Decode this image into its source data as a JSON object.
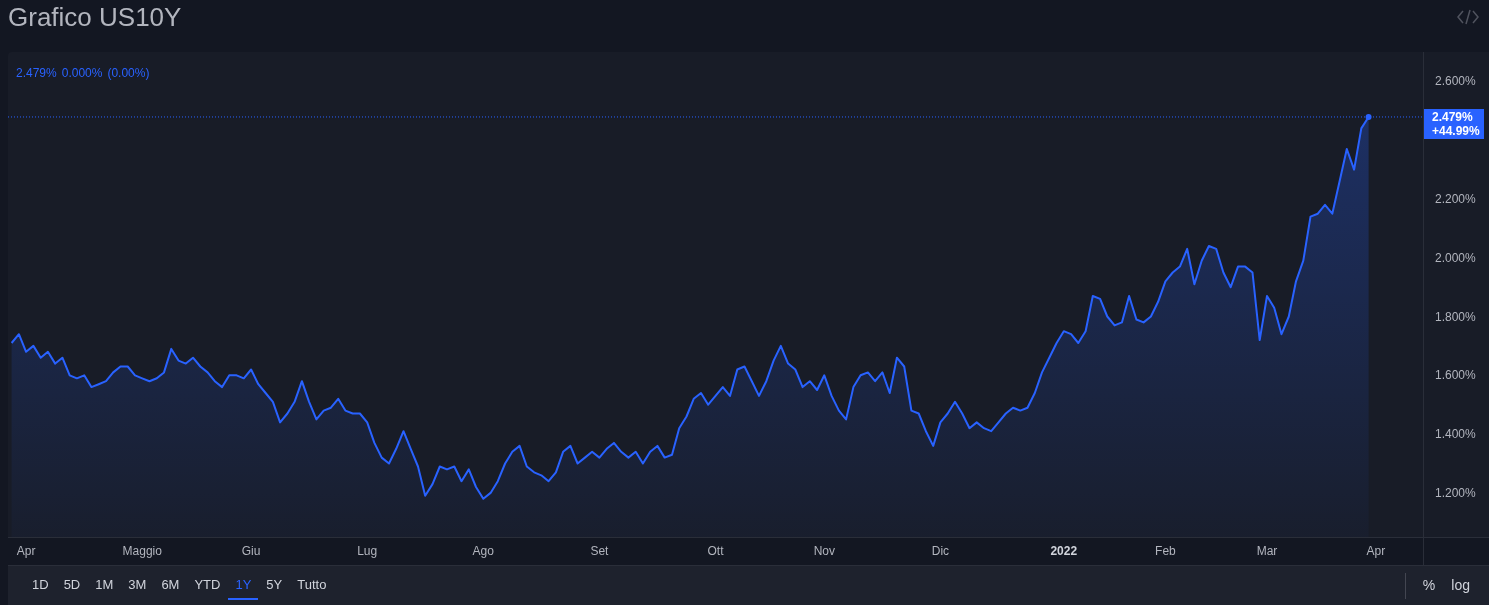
{
  "header": {
    "title": "Grafico US10Y"
  },
  "legend": {
    "price": "2.479%",
    "change": "0.000%",
    "change_pct": "(0.00%)"
  },
  "price_badge": {
    "price": "2.479%",
    "change": "+44.99%"
  },
  "chart_data": {
    "type": "area",
    "ylim": [
      1.05,
      2.7
    ],
    "ref_lines": [
      {
        "axis": "y",
        "value": 2.479
      }
    ],
    "categories": [
      null,
      null,
      "Apr",
      null,
      null,
      null,
      null,
      null,
      null,
      null,
      null,
      null,
      null,
      null,
      null,
      null,
      null,
      null,
      "Maggio",
      null,
      null,
      null,
      null,
      null,
      null,
      null,
      null,
      null,
      null,
      null,
      null,
      null,
      null,
      "Giu",
      null,
      null,
      null,
      null,
      null,
      null,
      null,
      null,
      null,
      null,
      null,
      null,
      null,
      null,
      null,
      "Lug",
      null,
      null,
      null,
      null,
      null,
      null,
      null,
      null,
      null,
      null,
      null,
      null,
      null,
      null,
      null,
      "Ago",
      null,
      null,
      null,
      null,
      null,
      null,
      null,
      null,
      null,
      null,
      null,
      null,
      null,
      null,
      null,
      "Set",
      null,
      null,
      null,
      null,
      null,
      null,
      null,
      null,
      null,
      null,
      null,
      null,
      null,
      null,
      null,
      "Ott",
      null,
      null,
      null,
      null,
      null,
      null,
      null,
      null,
      null,
      null,
      null,
      null,
      null,
      null,
      "Nov",
      null,
      null,
      null,
      null,
      null,
      null,
      null,
      null,
      null,
      null,
      null,
      null,
      null,
      null,
      null,
      "Dic",
      null,
      null,
      null,
      null,
      null,
      null,
      null,
      null,
      null,
      null,
      null,
      null,
      null,
      null,
      null,
      null,
      "2022",
      null,
      null,
      null,
      null,
      null,
      null,
      null,
      null,
      null,
      null,
      null,
      null,
      null,
      "Feb",
      null,
      null,
      null,
      null,
      null,
      null,
      null,
      null,
      null,
      null,
      null,
      null,
      null,
      "Mar",
      null,
      null,
      null,
      null,
      null,
      null,
      null,
      null,
      null,
      null,
      null,
      null,
      null,
      null,
      "Apr",
      null,
      null,
      null,
      null,
      null,
      null
    ],
    "yticks": [
      {
        "value": 1.2,
        "label": "1.200%"
      },
      {
        "value": 1.4,
        "label": "1.400%"
      },
      {
        "value": 1.6,
        "label": "1.600%"
      },
      {
        "value": 1.8,
        "label": "1.800%"
      },
      {
        "value": 2.0,
        "label": "2.000%"
      },
      {
        "value": 2.2,
        "label": "2.200%"
      },
      {
        "value": 2.6,
        "label": "2.600%"
      }
    ],
    "series": [
      {
        "color": "#2962ff",
        "values": [
          1.71,
          1.74,
          1.68,
          1.7,
          1.66,
          1.68,
          1.64,
          1.66,
          1.6,
          1.59,
          1.6,
          1.56,
          1.57,
          1.58,
          1.61,
          1.63,
          1.63,
          1.6,
          1.59,
          1.58,
          1.59,
          1.61,
          1.69,
          1.65,
          1.64,
          1.66,
          1.63,
          1.61,
          1.58,
          1.56,
          1.6,
          1.6,
          1.59,
          1.62,
          1.57,
          1.54,
          1.51,
          1.44,
          1.47,
          1.51,
          1.58,
          1.51,
          1.45,
          1.48,
          1.49,
          1.52,
          1.48,
          1.47,
          1.47,
          1.44,
          1.37,
          1.32,
          1.3,
          1.35,
          1.41,
          1.35,
          1.29,
          1.19,
          1.23,
          1.29,
          1.28,
          1.29,
          1.24,
          1.28,
          1.22,
          1.18,
          1.2,
          1.24,
          1.3,
          1.34,
          1.36,
          1.29,
          1.27,
          1.26,
          1.24,
          1.27,
          1.34,
          1.36,
          1.3,
          1.32,
          1.34,
          1.32,
          1.35,
          1.37,
          1.34,
          1.32,
          1.34,
          1.3,
          1.34,
          1.36,
          1.32,
          1.33,
          1.42,
          1.46,
          1.52,
          1.54,
          1.5,
          1.53,
          1.56,
          1.53,
          1.62,
          1.63,
          1.58,
          1.53,
          1.58,
          1.65,
          1.7,
          1.64,
          1.62,
          1.56,
          1.58,
          1.55,
          1.6,
          1.53,
          1.48,
          1.45,
          1.56,
          1.6,
          1.61,
          1.58,
          1.61,
          1.54,
          1.66,
          1.63,
          1.48,
          1.47,
          1.41,
          1.36,
          1.44,
          1.47,
          1.51,
          1.47,
          1.42,
          1.44,
          1.42,
          1.41,
          1.44,
          1.47,
          1.49,
          1.48,
          1.49,
          1.54,
          1.61,
          1.66,
          1.71,
          1.75,
          1.74,
          1.71,
          1.75,
          1.87,
          1.86,
          1.8,
          1.77,
          1.78,
          1.87,
          1.79,
          1.78,
          1.8,
          1.85,
          1.92,
          1.95,
          1.97,
          2.03,
          1.91,
          1.99,
          2.04,
          2.03,
          1.95,
          1.9,
          1.97,
          1.97,
          1.95,
          1.72,
          1.87,
          1.83,
          1.74,
          1.8,
          1.92,
          1.99,
          2.14,
          2.15,
          2.18,
          2.15,
          2.26,
          2.37,
          2.3,
          2.44,
          2.479,
          null,
          null,
          null,
          null,
          null,
          null,
          null
        ]
      }
    ]
  },
  "ranges": [
    {
      "label": "1D",
      "selected": false
    },
    {
      "label": "5D",
      "selected": false
    },
    {
      "label": "1M",
      "selected": false
    },
    {
      "label": "3M",
      "selected": false
    },
    {
      "label": "6M",
      "selected": false
    },
    {
      "label": "YTD",
      "selected": false
    },
    {
      "label": "1Y",
      "selected": true
    },
    {
      "label": "5Y",
      "selected": false
    },
    {
      "label": "Tutto",
      "selected": false
    }
  ],
  "scale_buttons": [
    "%",
    "log"
  ]
}
